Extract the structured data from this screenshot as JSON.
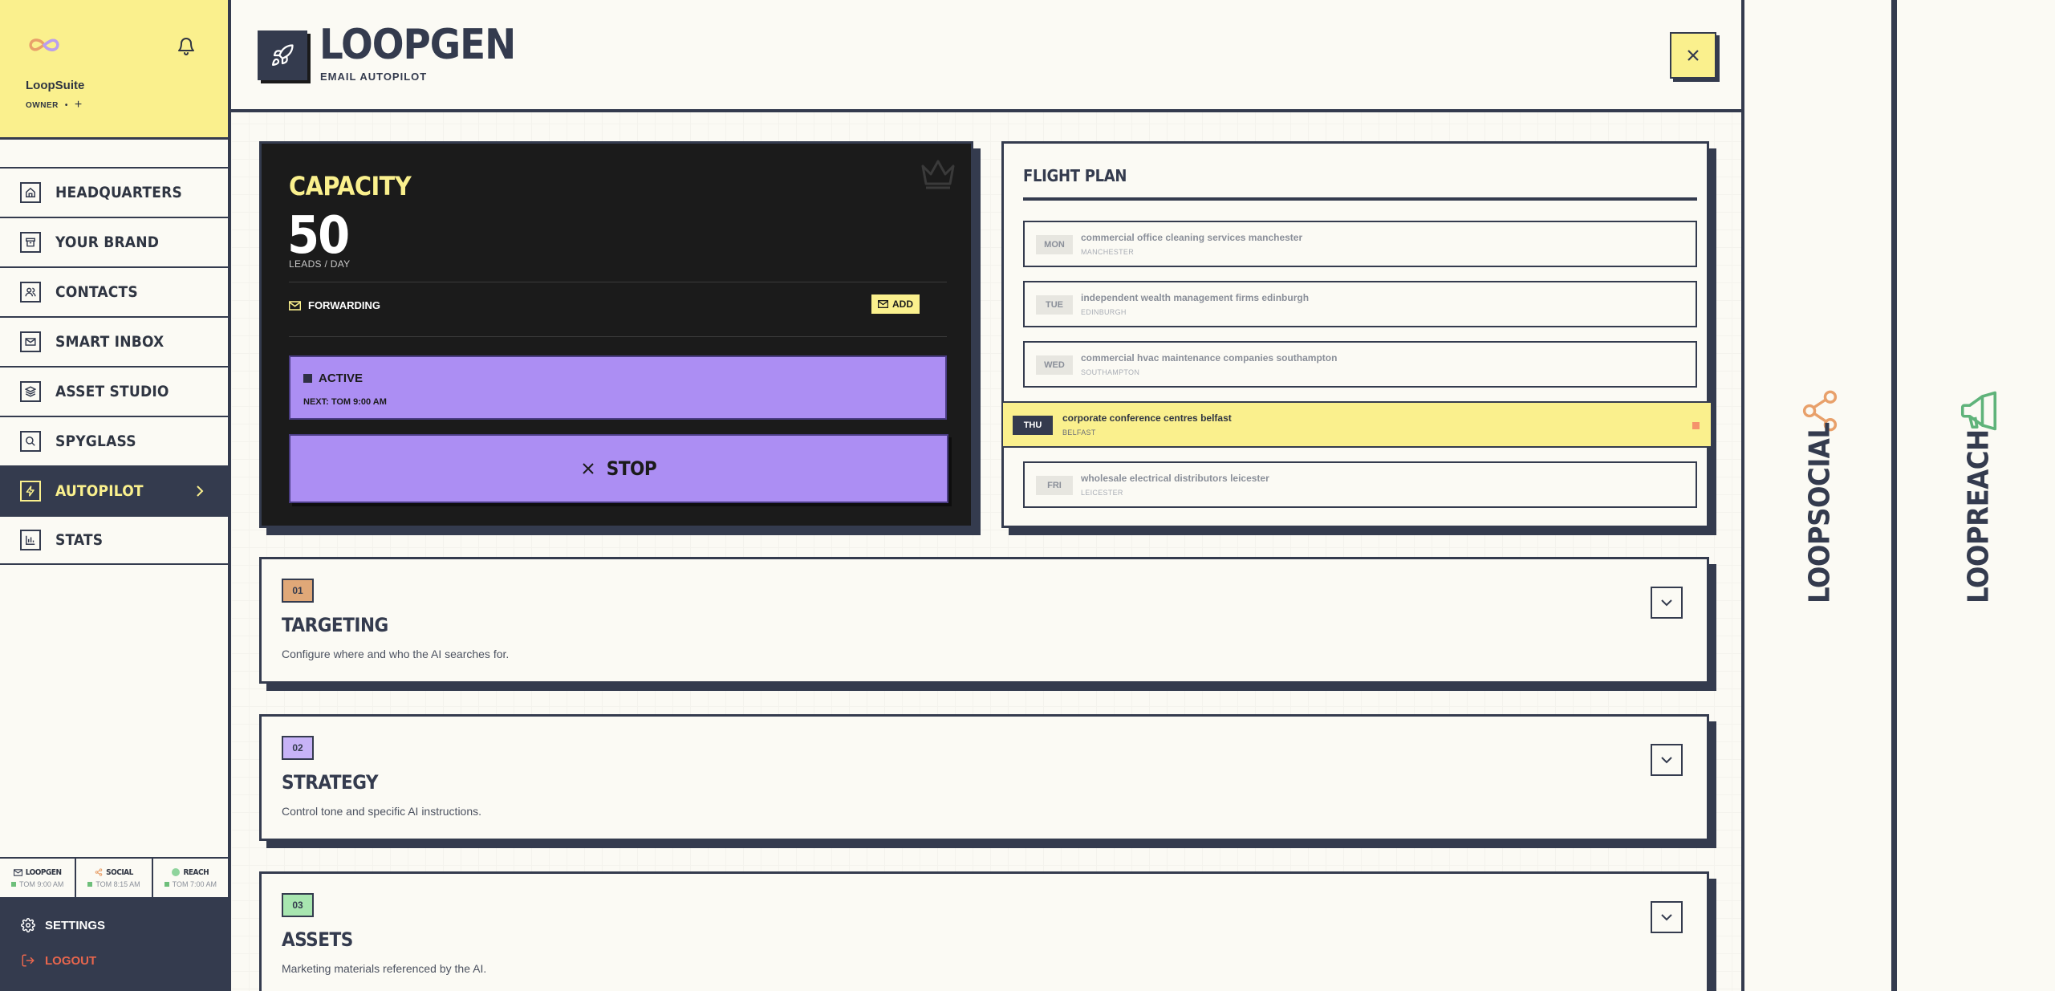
{
  "sidebar": {
    "workspace_name": "LoopSuite",
    "role": "OWNER",
    "role_separator": "•",
    "add_symbol": "+",
    "items": [
      {
        "label": "HEADQUARTERS",
        "icon": "home-icon"
      },
      {
        "label": "YOUR BRAND",
        "icon": "box-icon"
      },
      {
        "label": "CONTACTS",
        "icon": "users-icon"
      },
      {
        "label": "SMART INBOX",
        "icon": "mail-icon"
      },
      {
        "label": "ASSET STUDIO",
        "icon": "layers-icon"
      },
      {
        "label": "SPYGLASS",
        "icon": "search-icon"
      },
      {
        "label": "AUTOPILOT",
        "icon": "zap-icon",
        "active": true
      },
      {
        "label": "STATS",
        "icon": "bar-chart-icon"
      }
    ],
    "status": [
      {
        "name": "LOOPGEN",
        "time": "TOM 9:00 AM"
      },
      {
        "name": "SOCIAL",
        "time": "TOM 8:15 AM"
      },
      {
        "name": "REACH",
        "time": "TOM 7:00 AM"
      }
    ],
    "settings_label": "SETTINGS",
    "logout_label": "LOGOUT"
  },
  "header": {
    "title": "LOOPGEN",
    "subtitle": "EMAIL AUTOPILOT"
  },
  "capacity": {
    "title": "CAPACITY",
    "value": "50",
    "unit": "LEADS / DAY",
    "forwarding_label": "FORWARDING",
    "add_label": "ADD",
    "status_label": "ACTIVE",
    "next_run": "NEXT: TOM 9:00 AM",
    "stop_label": "STOP"
  },
  "flight_plan": {
    "title": "FLIGHT PLAN",
    "rows": [
      {
        "day": "MON",
        "query": "commercial office cleaning services manchester",
        "location": "MANCHESTER"
      },
      {
        "day": "TUE",
        "query": "independent wealth management firms edinburgh",
        "location": "EDINBURGH"
      },
      {
        "day": "WED",
        "query": "commercial hvac maintenance companies southampton",
        "location": "SOUTHAMPTON"
      },
      {
        "day": "THU",
        "query": "corporate conference centres belfast",
        "location": "BELFAST",
        "current": true
      },
      {
        "day": "FRI",
        "query": "wholesale electrical distributors leicester",
        "location": "LEICESTER"
      }
    ]
  },
  "sections": [
    {
      "num": "01",
      "title": "TARGETING",
      "desc": "Configure where and who the AI searches for.",
      "color": "#e0a878"
    },
    {
      "num": "02",
      "title": "STRATEGY",
      "desc": "Control tone and specific AI instructions.",
      "color": "#c7b3f7"
    },
    {
      "num": "03",
      "title": "ASSETS",
      "desc": "Marketing materials referenced by the AI.",
      "color": "#a8e6b0"
    }
  ],
  "panels": {
    "social_label": "LOOPSOCIAL",
    "reach_label": "LOOPREACH"
  },
  "colors": {
    "navy": "#343b4e",
    "yellow": "#faf08d",
    "purple": "#ac8ef3",
    "orange": "#e8a06a",
    "green": "#5fb37a",
    "danger": "#e8664d"
  }
}
